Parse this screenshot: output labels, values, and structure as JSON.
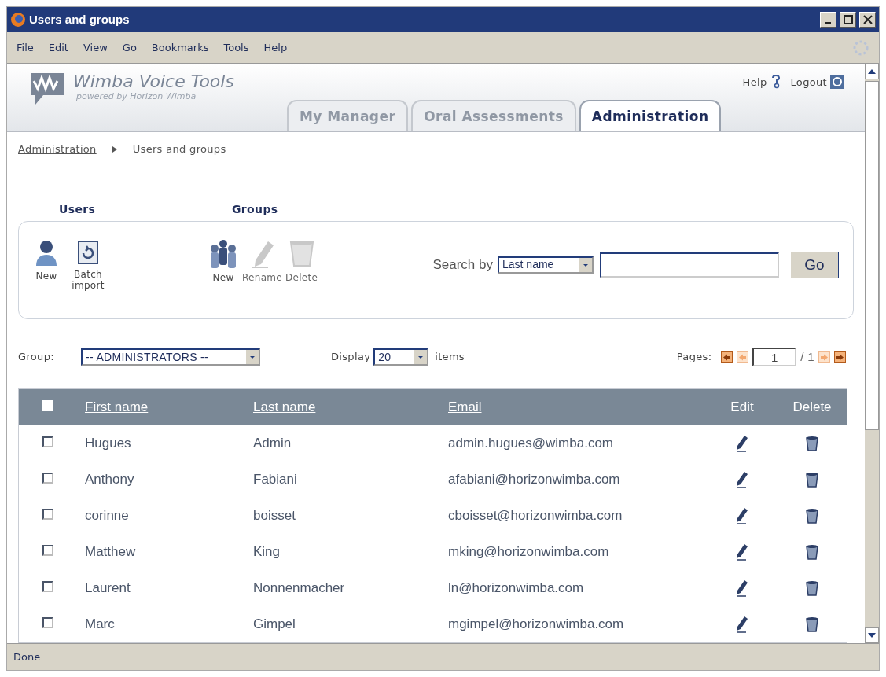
{
  "window": {
    "title": "Users and groups"
  },
  "menu": [
    "File",
    "Edit",
    "View",
    "Go",
    "Bookmarks",
    "Tools",
    "Help"
  ],
  "header": {
    "logo_title": "Wimba Voice Tools",
    "logo_subtitle": "powered by Horizon Wimba",
    "links": [
      "Help",
      "Logout"
    ]
  },
  "tabs": [
    {
      "label": "My Manager",
      "selected": false
    },
    {
      "label": "Oral Assessments",
      "selected": false
    },
    {
      "label": "Administration",
      "selected": true
    }
  ],
  "breadcrumb": {
    "link": "Administration",
    "current": "Users and groups"
  },
  "actions": {
    "users_title": "Users",
    "groups_title": "Groups",
    "users": [
      {
        "kind": "user",
        "label": "New",
        "disabled": false
      },
      {
        "kind": "import",
        "label": "Batch import",
        "disabled": false
      }
    ],
    "groups": [
      {
        "kind": "group",
        "label": "New",
        "disabled": false
      },
      {
        "kind": "rename",
        "label": "Rename",
        "disabled": true
      },
      {
        "kind": "delete",
        "label": "Delete",
        "disabled": true
      }
    ],
    "search_label": "Search by",
    "search_by": "Last name",
    "search_button": "Go"
  },
  "filters": {
    "group_label": "Group:",
    "group": "-- ADMINISTRATORS --",
    "display_label": "Display",
    "display": "20",
    "items_label": "items",
    "pages_label": "Pages:",
    "page": "1",
    "page_total": "/ 1"
  },
  "table": {
    "select_all": {
      "checked": false
    },
    "columns": [
      "First name",
      "Last name",
      "Email",
      "Edit",
      "Delete"
    ],
    "rows": [
      {
        "checked": false,
        "first": "Hugues",
        "last": "Admin",
        "email": "admin.hugues@wimba.com"
      },
      {
        "checked": false,
        "first": "Anthony",
        "last": "Fabiani",
        "email": "afabiani@horizonwimba.com"
      },
      {
        "checked": false,
        "first": "corinne",
        "last": "boisset",
        "email": "cboisset@horizonwimba.com"
      },
      {
        "checked": false,
        "first": "Matthew",
        "last": "King",
        "email": "mking@horizonwimba.com"
      },
      {
        "checked": false,
        "first": "Laurent",
        "last": "Nonnenmacher",
        "email": "ln@horizonwimba.com"
      },
      {
        "checked": false,
        "first": "Marc",
        "last": "Gimpel",
        "email": "mgimpel@horizonwimba.com"
      }
    ]
  },
  "status_bar": "Done"
}
